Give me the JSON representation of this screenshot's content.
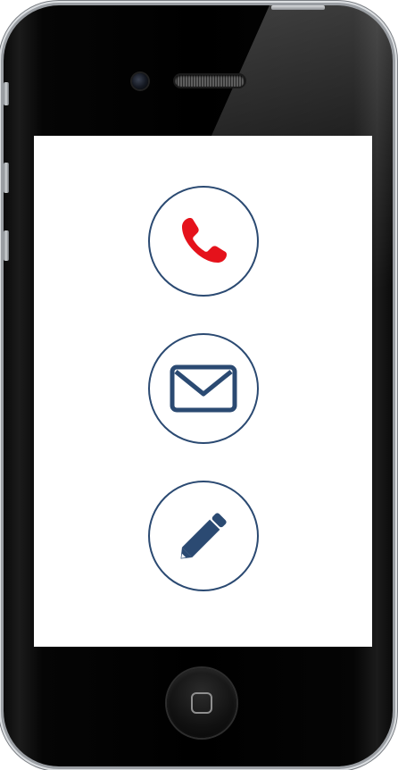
{
  "device": {
    "frame_color": "#000000",
    "screen_color": "#ffffff"
  },
  "screen": {
    "actions": [
      {
        "name": "call",
        "icon": "phone-icon",
        "color": "#e5121b"
      },
      {
        "name": "email",
        "icon": "envelope-icon",
        "color": "#2b4a72"
      },
      {
        "name": "write",
        "icon": "pencil-icon",
        "color": "#2b4a72"
      }
    ],
    "circle_border_color": "#2b4a72"
  },
  "hardware": {
    "home_button_icon": "home-square-icon",
    "camera_icon": "front-camera-icon",
    "speaker_icon": "earpiece-speaker-icon"
  }
}
